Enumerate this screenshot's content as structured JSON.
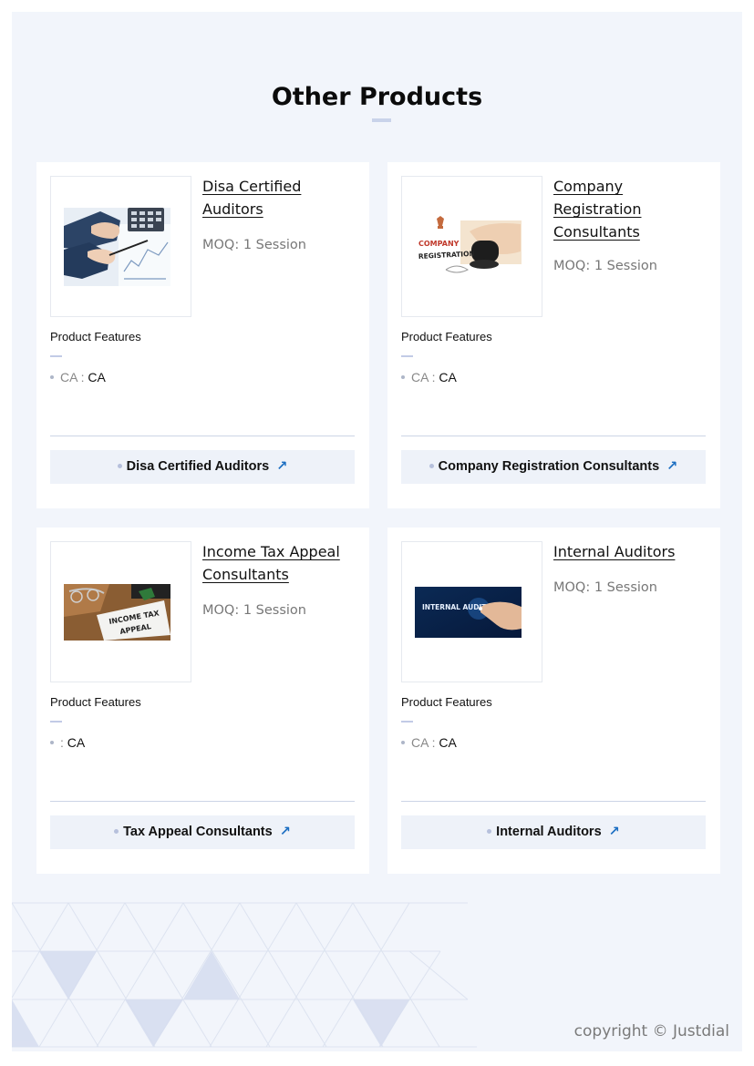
{
  "section": {
    "title": "Other Products"
  },
  "products": [
    {
      "name": "Disa Certified Auditors",
      "moq": "MOQ: 1 Session",
      "features_label": "Product Features",
      "feature_key": "CA",
      "feature_value": "CA",
      "cta_label": "Disa Certified Auditors",
      "image_icon": "auditor-calculator-image"
    },
    {
      "name": "Company Registration Consultants",
      "moq": "MOQ: 1 Session",
      "features_label": "Product Features",
      "feature_key": "CA",
      "feature_value": "CA",
      "cta_label": "Company Registration Consultants",
      "image_icon": "company-registration-stamp-image",
      "image_text_line1": "COMPANY",
      "image_text_line2": "REGISTRATION"
    },
    {
      "name": "Income Tax Appeal Consultants",
      "moq": "MOQ: 1 Session",
      "features_label": "Product Features",
      "feature_key": "",
      "feature_value": "CA",
      "cta_label": "Tax Appeal Consultants",
      "image_icon": "income-tax-appeal-document-image",
      "image_text_line1": "INCOME TAX",
      "image_text_line2": "APPEAL"
    },
    {
      "name": "Internal Auditors",
      "moq": "MOQ: 1 Session",
      "features_label": "Product Features",
      "feature_key": "CA",
      "feature_value": "CA",
      "cta_label": "Internal Auditors",
      "image_icon": "internal-audit-screen-image",
      "image_text_line1": "INTERNAL AUDIT"
    }
  ],
  "footer": {
    "copyright": "copyright © Justdial"
  },
  "colors": {
    "background": "#f2f5fb",
    "accent": "#1b6ec2",
    "bar": "#c9d3ea"
  }
}
